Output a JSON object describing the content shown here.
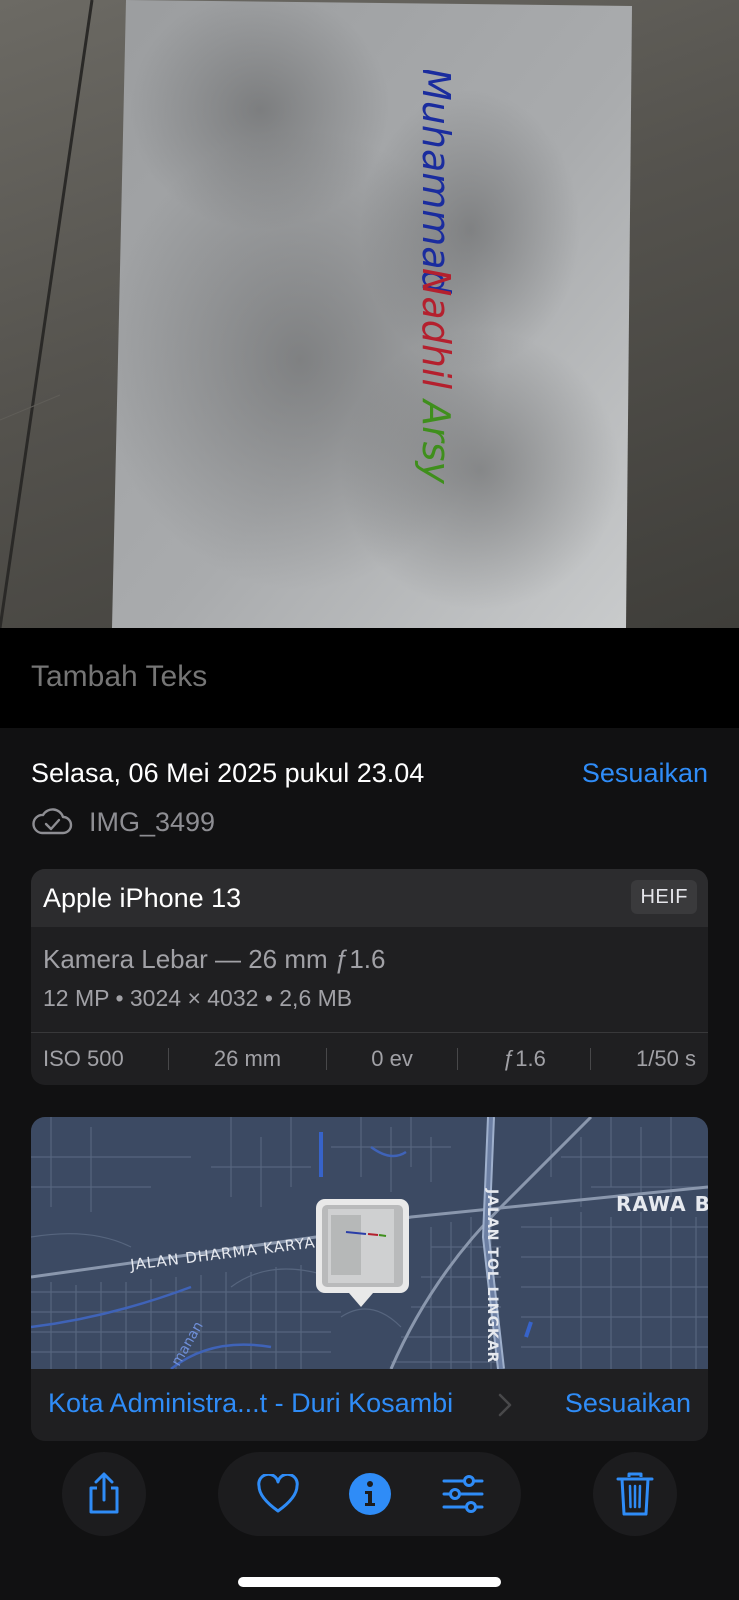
{
  "photo": {
    "handwritten_name": [
      "Muhammad",
      "Nadhil",
      "Arsy"
    ],
    "name_colors": [
      "#1a2c9e",
      "#b4202e",
      "#3f8f1c"
    ]
  },
  "caption": {
    "placeholder": "Tambah Teks"
  },
  "info": {
    "date": "Selasa, 06 Mei 2025 pukul 23.04",
    "adjust_label": "Sesuaikan",
    "filename": "IMG_3499",
    "cloud_icon": "icloud-synced-icon"
  },
  "camera": {
    "device": "Apple iPhone 13",
    "format": "HEIF",
    "lens": "Kamera Lebar — 26 mm ƒ1.6",
    "specs": "12 MP • 3024 × 4032 • 2,6 MB",
    "exif": {
      "iso": "ISO 500",
      "focal": "26 mm",
      "ev": "0 ev",
      "aperture": "ƒ1.6",
      "shutter": "1/50 s"
    }
  },
  "map": {
    "labels": {
      "road": "JALAN DHARMA KARYA",
      "toll": "JALAN TOL LINGKAR",
      "area": "RAWA BU",
      "street": "manan"
    },
    "location": "Kota Administra...t - Duri Kosambi",
    "adjust_label": "Sesuaikan"
  },
  "toolbar": {
    "share_icon": "share-icon",
    "favorite_icon": "heart-icon",
    "info_icon": "info-icon",
    "edit_icon": "adjust-sliders-icon",
    "delete_icon": "trash-icon"
  },
  "colors": {
    "accent": "#2f8cf7",
    "panel": "#111112",
    "card": "#1f1f21",
    "map": "#3c4a63"
  }
}
